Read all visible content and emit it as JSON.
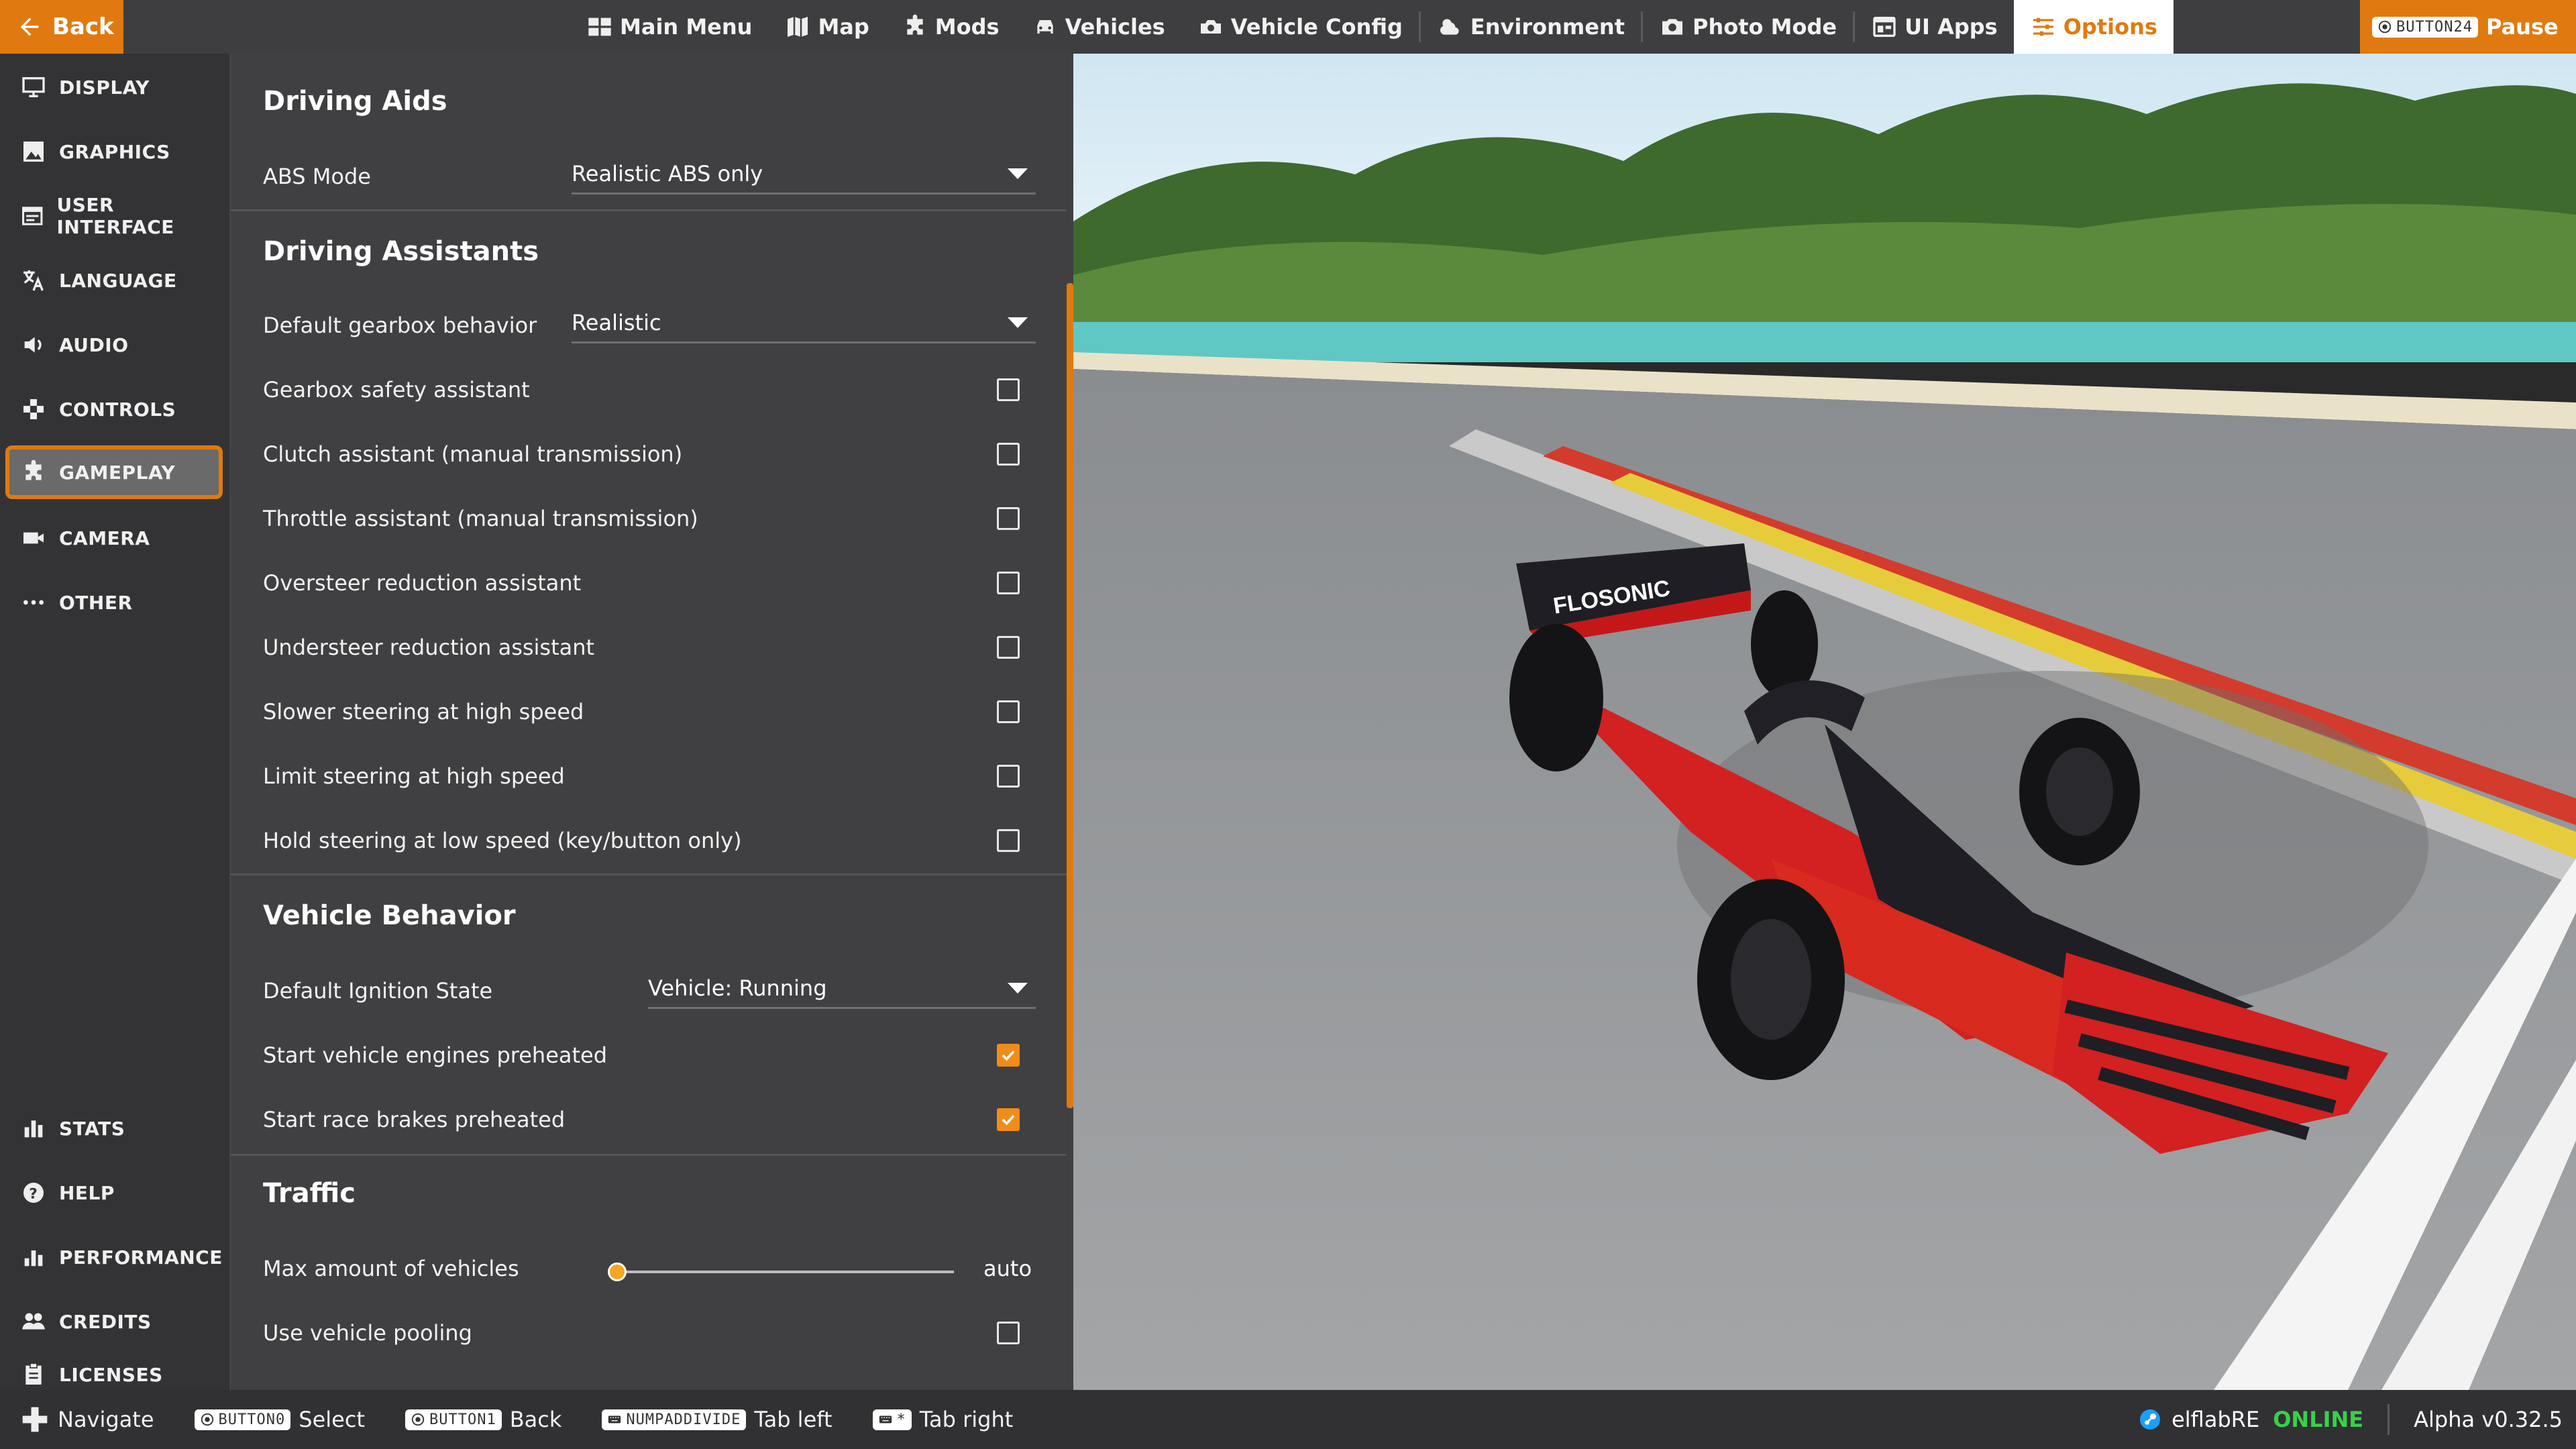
{
  "topbar": {
    "back_label": "Back",
    "menu": [
      {
        "label": "Main Menu",
        "icon": "main-menu-icon"
      },
      {
        "label": "Map",
        "icon": "map-icon"
      },
      {
        "label": "Mods",
        "icon": "puzzle-icon"
      },
      {
        "label": "Vehicles",
        "icon": "car-icon"
      },
      {
        "label": "Vehicle Config",
        "icon": "vehicle-config-icon"
      },
      {
        "label": "Environment",
        "icon": "weather-icon"
      },
      {
        "label": "Photo Mode",
        "icon": "camera-icon"
      },
      {
        "label": "UI Apps",
        "icon": "ui-apps-icon"
      },
      {
        "label": "Options",
        "icon": "options-sliders-icon"
      }
    ],
    "active_menu": "Options",
    "pause_key": "BUTTON24",
    "pause_label": "Pause"
  },
  "sidebar": {
    "items": [
      {
        "label": "DISPLAY",
        "icon": "display-icon"
      },
      {
        "label": "GRAPHICS",
        "icon": "graphics-icon"
      },
      {
        "label": "USER INTERFACE",
        "icon": "user-interface-icon"
      },
      {
        "label": "LANGUAGE",
        "icon": "language-icon"
      },
      {
        "label": "AUDIO",
        "icon": "audio-icon"
      },
      {
        "label": "CONTROLS",
        "icon": "controls-icon"
      },
      {
        "label": "GAMEPLAY",
        "icon": "gameplay-icon"
      },
      {
        "label": "CAMERA",
        "icon": "camera-icon"
      },
      {
        "label": "OTHER",
        "icon": "more-icon"
      }
    ],
    "bottom_items": [
      {
        "label": "STATS",
        "icon": "stats-icon"
      },
      {
        "label": "HELP",
        "icon": "help-icon"
      },
      {
        "label": "PERFORMANCE",
        "icon": "performance-icon"
      },
      {
        "label": "CREDITS",
        "icon": "credits-icon"
      },
      {
        "label": "LICENSES",
        "icon": "licenses-icon"
      }
    ],
    "active": "GAMEPLAY"
  },
  "options": {
    "driving_aids": {
      "title": "Driving Aids",
      "abs_label": "ABS Mode",
      "abs_value": "Realistic ABS only"
    },
    "driving_assistants": {
      "title": "Driving Assistants",
      "gearbox_label": "Default gearbox behavior",
      "gearbox_value": "Realistic",
      "checks": [
        {
          "label": "Gearbox safety assistant",
          "checked": false
        },
        {
          "label": "Clutch assistant (manual transmission)",
          "checked": false
        },
        {
          "label": "Throttle assistant (manual transmission)",
          "checked": false
        },
        {
          "label": "Oversteer reduction assistant",
          "checked": false
        },
        {
          "label": "Understeer reduction assistant",
          "checked": false
        },
        {
          "label": "Slower steering at high speed",
          "checked": false
        },
        {
          "label": "Limit steering at high speed",
          "checked": false
        },
        {
          "label": "Hold steering at low speed (key/button only)",
          "checked": false
        }
      ]
    },
    "vehicle_behavior": {
      "title": "Vehicle Behavior",
      "ignition_label": "Default Ignition State",
      "ignition_value": "Vehicle: Running",
      "checks": [
        {
          "label": "Start vehicle engines preheated",
          "checked": true
        },
        {
          "label": "Start race brakes preheated",
          "checked": true
        }
      ]
    },
    "traffic": {
      "title": "Traffic",
      "max_vehicles_label": "Max amount of vehicles",
      "max_vehicles_value": "auto",
      "max_vehicles_fraction": 0.0,
      "pooling_label": "Use vehicle pooling",
      "pooling_checked": false
    }
  },
  "viewport": {
    "wing_text": "FLOSONIC"
  },
  "bottombar": {
    "navigate_label": "Navigate",
    "select_key": "BUTTON0",
    "select_label": "Select",
    "back_key": "BUTTON1",
    "back_label": "Back",
    "tab_left_key": "NUMPADDIVIDE",
    "tab_left_label": "Tab left",
    "tab_right_key": "*",
    "tab_right_label": "Tab right",
    "username": "elflabRE",
    "online_label": "ONLINE",
    "version": "Alpha v0.32.5"
  },
  "colors": {
    "accent": "#e07a10",
    "online": "#39d04a",
    "checkbox_checked": "#f08c1a"
  }
}
